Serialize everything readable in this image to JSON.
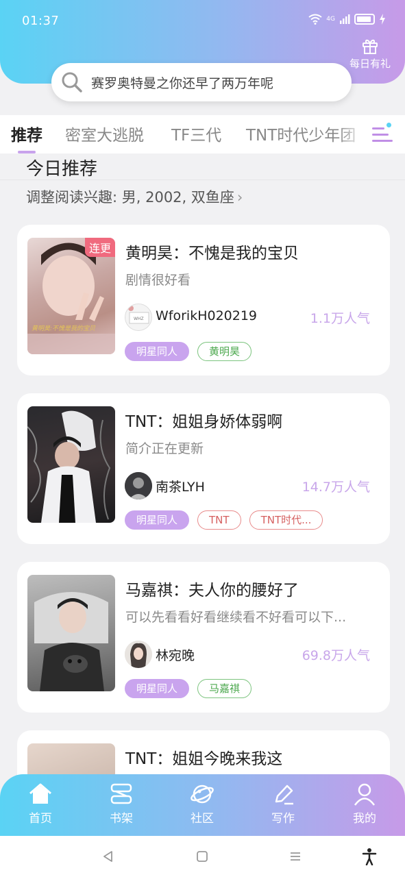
{
  "status_bar": {
    "time": "01:37",
    "network": "4G"
  },
  "header": {
    "gift_label": "每日有礼"
  },
  "search": {
    "text": "赛罗奥特曼之你还早了两万年呢"
  },
  "tabs": [
    {
      "label": "推荐"
    },
    {
      "label": "密室大逃脱"
    },
    {
      "label": "TF三代"
    },
    {
      "label": "TNT时代少年团"
    }
  ],
  "section": {
    "title": "今日推荐",
    "interest": "调整阅读兴趣: 男, 2002, 双鱼座"
  },
  "cards": [
    {
      "title": "黄明昊：不愧是我的宝贝",
      "desc": "剧情很好看",
      "badge": "连更",
      "author": "WforikH020219",
      "popularity": "1.1万人气",
      "tags": [
        {
          "label": "明星同人",
          "style": "purple"
        },
        {
          "label": "黄明昊",
          "style": "green"
        }
      ]
    },
    {
      "title": "TNT：姐姐身娇体弱啊",
      "desc": "简介正在更新",
      "author": "南茶LYH",
      "popularity": "14.7万人气",
      "tags": [
        {
          "label": "明星同人",
          "style": "purple"
        },
        {
          "label": "TNT",
          "style": "red"
        },
        {
          "label": "TNT时代...",
          "style": "red"
        }
      ]
    },
    {
      "title": "马嘉祺：夫人你的腰好了",
      "desc": "可以先看看好看继续看不好看可以下...",
      "author": "林宛晚",
      "popularity": "69.8万人气",
      "tags": [
        {
          "label": "明星同人",
          "style": "purple"
        },
        {
          "label": "马嘉祺",
          "style": "green"
        }
      ]
    },
    {
      "title": "TNT：姐姐今晚来我这"
    }
  ],
  "bottom_nav": [
    {
      "label": "首页",
      "icon": "home-icon"
    },
    {
      "label": "书架",
      "icon": "bookshelf-icon"
    },
    {
      "label": "社区",
      "icon": "planet-icon"
    },
    {
      "label": "写作",
      "icon": "pen-icon"
    },
    {
      "label": "我的",
      "icon": "user-icon"
    }
  ],
  "colors": {
    "gradient_start": "#5ad3f4",
    "gradient_end": "#c79ae8",
    "accent_purple": "#c9a4ee",
    "badge_red": "#f06a7e"
  }
}
